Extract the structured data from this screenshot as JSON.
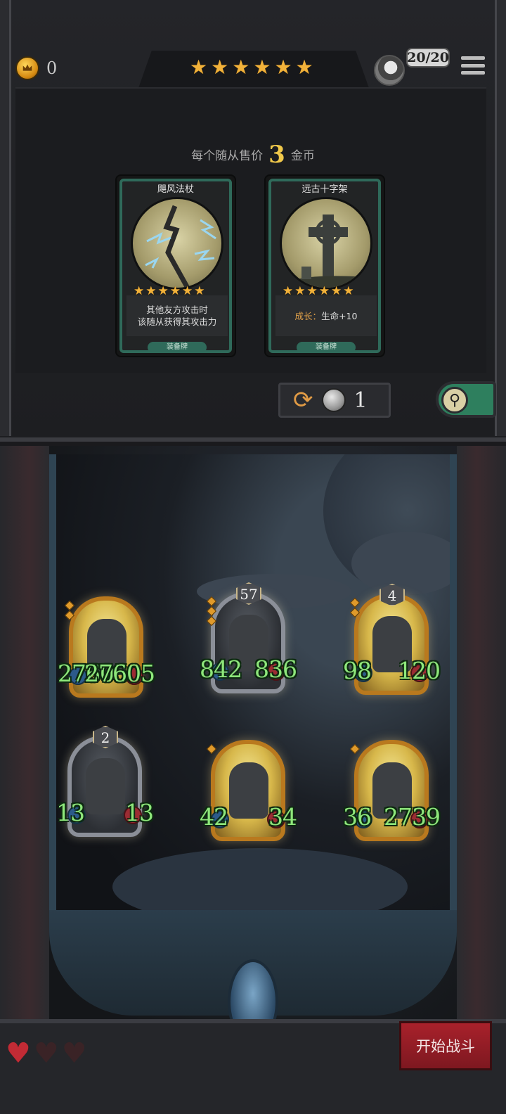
{
  "header": {
    "gold": "0",
    "shop_stars": 6,
    "population": "20/20"
  },
  "shop": {
    "price_prefix": "每个随从售价",
    "price_value": "3",
    "price_suffix": "金币",
    "cards": [
      {
        "title": "飓风法杖",
        "stars": 6,
        "desc_line1": "其他友方攻击时",
        "desc_line2": "该随从获得其攻击力",
        "tag": "装备牌"
      },
      {
        "title": "远古十字架",
        "stars": 6,
        "desc_grow_label": "成长：",
        "desc_grow_value": "生命+10",
        "tag": "装备牌"
      }
    ],
    "refresh_cost": "1"
  },
  "board": {
    "minions": [
      {
        "tier": "",
        "attack": "27605",
        "health": "27605",
        "frame": "gold",
        "pips": 2
      },
      {
        "tier": "57",
        "attack": "842",
        "health": "836",
        "frame": "silver",
        "pips": 3
      },
      {
        "tier": "4",
        "attack": "98",
        "health": "120",
        "frame": "gold",
        "pips": 2
      },
      {
        "tier": "2",
        "attack": "13",
        "health": "13",
        "frame": "silver",
        "pips": 0
      },
      {
        "tier": "",
        "attack": "42",
        "health": "34",
        "frame": "gold",
        "pips": 1
      },
      {
        "tier": "",
        "attack": "36",
        "health": "2739",
        "frame": "gold",
        "pips": 1
      }
    ]
  },
  "footer": {
    "lives_total": 3,
    "lives_remaining": 1,
    "start_label": "开始战斗"
  },
  "colors": {
    "stat_green": "#8ee77b",
    "gold_accent": "#f0c84a",
    "card_teal": "#2f6a5a",
    "start_red": "#a8212b"
  }
}
